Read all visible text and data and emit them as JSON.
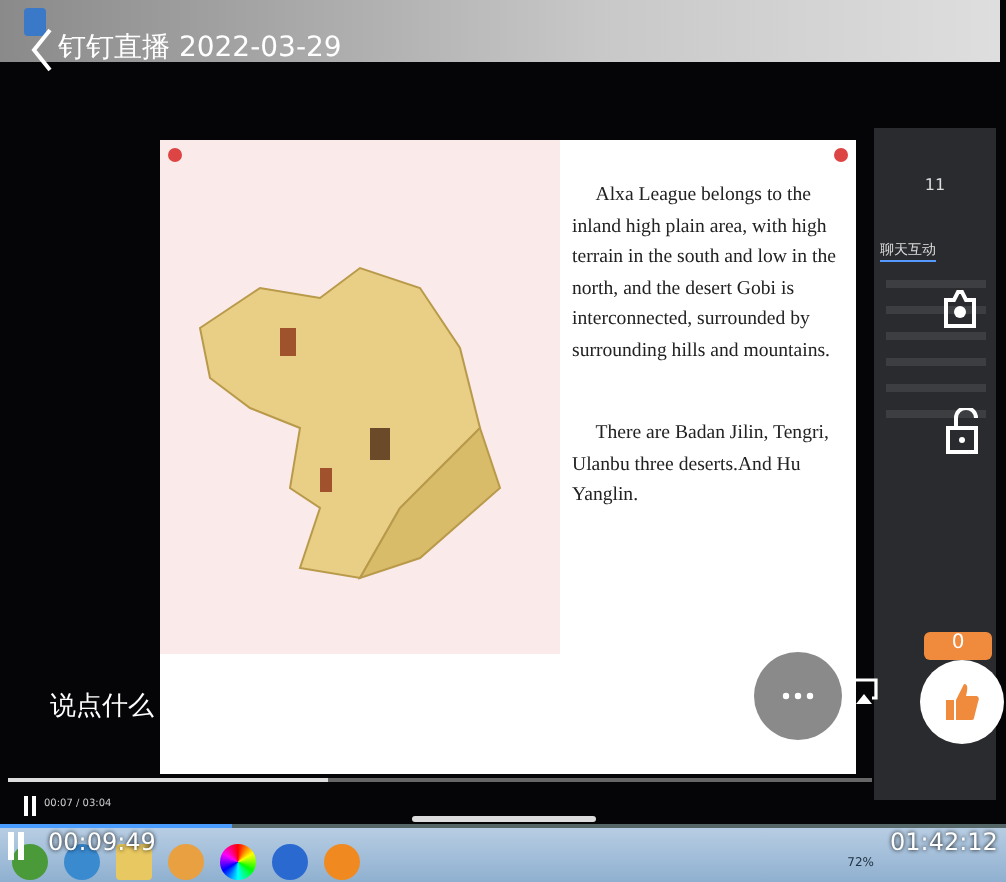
{
  "title": "钉钉直播 2022-03-29",
  "slide": {
    "paragraphs": [
      "Alxa League belongs to the inland high plain area, with high terrain in the south and low in the north, and the desert Gobi is interconnected, surrounded by  surrounding hills and mountains.",
      "There are Badan Jilin, Tengri, Ulanbu  three deserts.And Hu Yanglin."
    ]
  },
  "side_panel": {
    "count": "11",
    "tab": "聊天互动"
  },
  "comment_placeholder": "说点什么",
  "like_count": "0",
  "inner_player": {
    "time": "00:07 / 03:04",
    "level": 0.37
  },
  "outer_player": {
    "elapsed": "00:09:49",
    "remaining": "01:42:12",
    "level": 0.23
  },
  "tray": {
    "battery": "72%"
  }
}
